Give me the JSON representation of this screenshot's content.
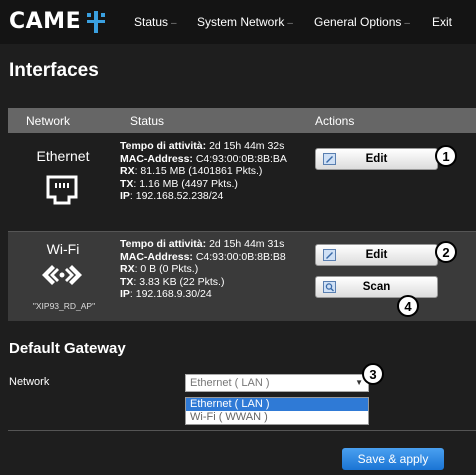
{
  "app": {
    "logo_text": "CAME"
  },
  "nav": {
    "items": [
      {
        "label": "Status",
        "caret": "–"
      },
      {
        "label": "System Network",
        "caret": "–"
      },
      {
        "label": "General Options",
        "caret": "–"
      },
      {
        "label": "Exit",
        "caret": ""
      }
    ]
  },
  "page": {
    "title": "Interfaces"
  },
  "table": {
    "headers": {
      "network": "Network",
      "status": "Status",
      "actions": "Actions"
    },
    "rows": [
      {
        "name": "Ethernet",
        "icon": "ethernet-port-icon",
        "uptime_label": "Tempo di attività:",
        "uptime": "2d 15h 44m 32s",
        "mac_label": "MAC-Address:",
        "mac": "C4:93:00:0B:8B:BA",
        "rx_label": "RX",
        "rx": ": 81.15 MB (1401861 Pkts.)",
        "tx_label": "TX",
        "tx": ": 1.16 MB (4497 Pkts.)",
        "ip_label": "IP",
        "ip": ": 192.168.52.238/24",
        "edit_label": "Edit",
        "callout": "1"
      },
      {
        "name": "Wi-Fi",
        "ssid": "\"XIP93_RD_AP\"",
        "icon": "wifi-arrows-icon",
        "uptime_label": "Tempo di attività:",
        "uptime": "2d 15h 44m 31s",
        "mac_label": "MAC-Address:",
        "mac": "C4:93:00:0B:8B:B8",
        "rx_label": "RX",
        "rx": ": 0 B (0 Pkts.)",
        "tx_label": "TX",
        "tx": ": 3.83 KB (22 Pkts.)",
        "ip_label": "IP",
        "ip": ": 192.168.9.30/24",
        "edit_label": "Edit",
        "scan_label": "Scan",
        "callout_edit": "2",
        "callout_scan": "4"
      }
    ]
  },
  "gateway": {
    "title": "Default Gateway",
    "network_label": "Network",
    "selected": "Ethernet ( LAN )",
    "callout": "3",
    "options": [
      "Ethernet ( LAN )",
      "Wi-Fi ( WWAN )"
    ]
  },
  "footer": {
    "save_label": "Save & apply"
  },
  "colors": {
    "accent": "#1a74d4",
    "header_bg": "#666666",
    "brand_icon": "#3aa0e0"
  }
}
